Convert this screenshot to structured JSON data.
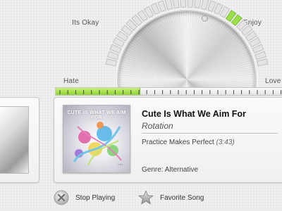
{
  "dial": {
    "labels": {
      "its_okay": "Its Okay",
      "enjoy": "Enjoy",
      "hate": "Hate",
      "love": "Love"
    },
    "active_color": "#9be04a"
  },
  "rating": {
    "level": 0.37
  },
  "now_playing": {
    "album_art_text": "CUTE IS WHAT WE AIM FOR",
    "song_title": "Cute Is What We Aim For",
    "artist": "Rotation",
    "album": "Practice Makes Perfect",
    "duration": "(3:43)",
    "genre": "Genre: Alternative"
  },
  "actions": {
    "stop": {
      "label": "Stop Playing",
      "icon": "stop-icon"
    },
    "favorite": {
      "label": "Favorite Song",
      "icon": "star-icon"
    }
  },
  "colors": {
    "accent_green": "#8fd232",
    "background": "#ececec"
  }
}
